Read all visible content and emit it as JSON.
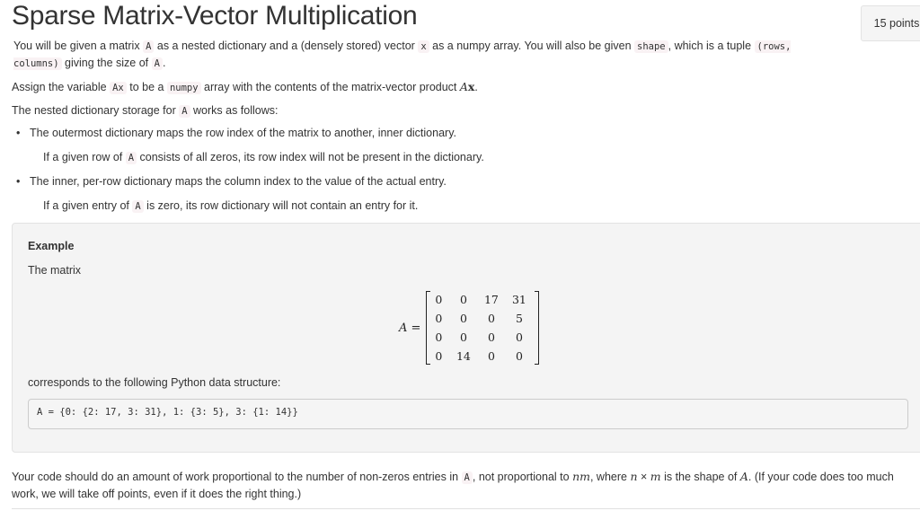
{
  "title": "Sparse Matrix-Vector Multiplication",
  "points_badge": "15 points",
  "intro": {
    "t1": "You will be given a matrix ",
    "c1": "A",
    "t2": " as a nested dictionary and a (densely stored) vector ",
    "c2": "x",
    "t3": " as a numpy array. You will also be given ",
    "c3": "shape",
    "t4": ", which is a tuple ",
    "c4": "(rows, columns)",
    "t5": " giving the size of ",
    "c5": "A",
    "t6": "."
  },
  "assign": {
    "t1": "Assign the variable ",
    "c1": "Ax",
    "t2": " to be a ",
    "c2": "numpy",
    "t3": " array with the contents of the matrix-vector product ",
    "m1": "A",
    "m2": "x",
    "t4": "."
  },
  "storage": {
    "t1": "The nested dictionary storage for ",
    "c1": "A",
    "t2": " works as follows:"
  },
  "bullets": [
    {
      "text": "The outermost dictionary maps the row index of the matrix to another, inner dictionary.",
      "sub_t1": "If a given row of ",
      "sub_c1": "A",
      "sub_t2": " consists of all zeros, its row index will not be present in the dictionary."
    },
    {
      "text": "The inner, per-row dictionary maps the column index to the value of the actual entry.",
      "sub_t1": "If a given entry of ",
      "sub_c1": "A",
      "sub_t2": " is zero, its row dictionary will not contain an entry for it."
    }
  ],
  "example": {
    "title": "Example",
    "matrix_label": "The matrix",
    "lhs_var": "A",
    "lhs_eq": " =",
    "matrix": [
      [
        "0",
        "0",
        "17",
        "31"
      ],
      [
        "0",
        "0",
        "0",
        "5"
      ],
      [
        "0",
        "0",
        "0",
        "0"
      ],
      [
        "0",
        "14",
        "0",
        "0"
      ]
    ],
    "corresponds": "corresponds to the following Python data structure:",
    "code": "A = {0: {2: 17, 3: 31}, 1: {3: 5}, 3: {1: 14}}"
  },
  "footer": {
    "t1": "Your code should do an amount of work proportional to the number of non-zeros entries in ",
    "c1": "A",
    "t2": ", not proportional to ",
    "m1": "nm",
    "t3": ", where ",
    "m2": "n",
    "times": " × ",
    "m3": "m",
    "t4": " is the shape of ",
    "m4": "A",
    "t5": ". (If your code does too much work, we will take off points, even if it does the right thing.)"
  }
}
